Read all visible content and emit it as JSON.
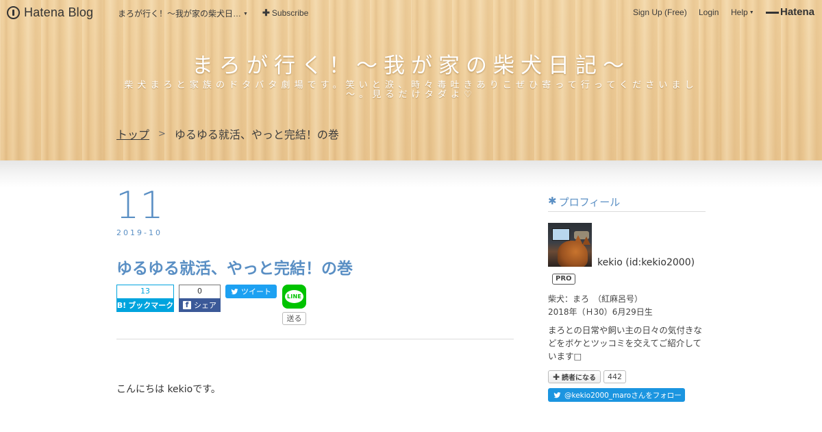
{
  "topbar": {
    "logo_text": "Hatena Blog",
    "blog_name": "まろが行く！～我が家の柴犬日…",
    "subscribe": "Subscribe",
    "signup": "Sign Up (Free)",
    "login": "Login",
    "help": "Help",
    "hatena": "Hatena"
  },
  "header": {
    "title": "まろが行く！～我が家の柴犬日記～",
    "description": "柴犬まろと家族のドタバタ劇場です。笑いと涙、時々毒吐きありこぜひ寄って行ってくださいまし～。見るだけタダよ♡",
    "breadcrumb_top": "トップ",
    "breadcrumb_sep": ">",
    "breadcrumb_current": "ゆるゆる就活、やっと完結！の巻"
  },
  "entry": {
    "day": "11",
    "year_month": "2019-10",
    "title": "ゆるゆる就活、やっと完結！の巻",
    "share": {
      "hatena_count": "13",
      "hatena_label": "ブックマーク",
      "hatena_b": "B!",
      "facebook_count": "0",
      "facebook_label": "シェア",
      "facebook_f": "f",
      "tweet_label": "ツイート",
      "line_icon_text": "LINE",
      "line_send": "送る"
    },
    "body_first_line": "こんにちは kekioです。"
  },
  "sidebar": {
    "profile_heading": "プロフィール",
    "name": "kekio (id:kekio2000)",
    "pro_badge": "PRO",
    "line1": "柴犬：まろ　（紅麻呂号）",
    "line2": "2018年（Ｈ30）6月29日生",
    "description": "まろとの日常や飼い主の日々の気付きなどをボケとツッコミを交えてご紹介しています□",
    "reader_button": "読者になる",
    "reader_count": "442",
    "follow_button": "@kekio2000_maroさんをフォロー"
  },
  "colors": {
    "accent": "#5a8fc4",
    "hatena_blue": "#00a4de",
    "facebook_blue": "#3b5998",
    "twitter_blue": "#1da1f2",
    "line_green": "#00c300",
    "header_wood": "#ebc48a"
  },
  "icons": {
    "logo": "hatena-blog-logo-icon",
    "plus": "plus-icon",
    "caret": "caret-down-icon",
    "twitter": "twitter-bird-icon",
    "asterisk": "asterisk-icon"
  }
}
